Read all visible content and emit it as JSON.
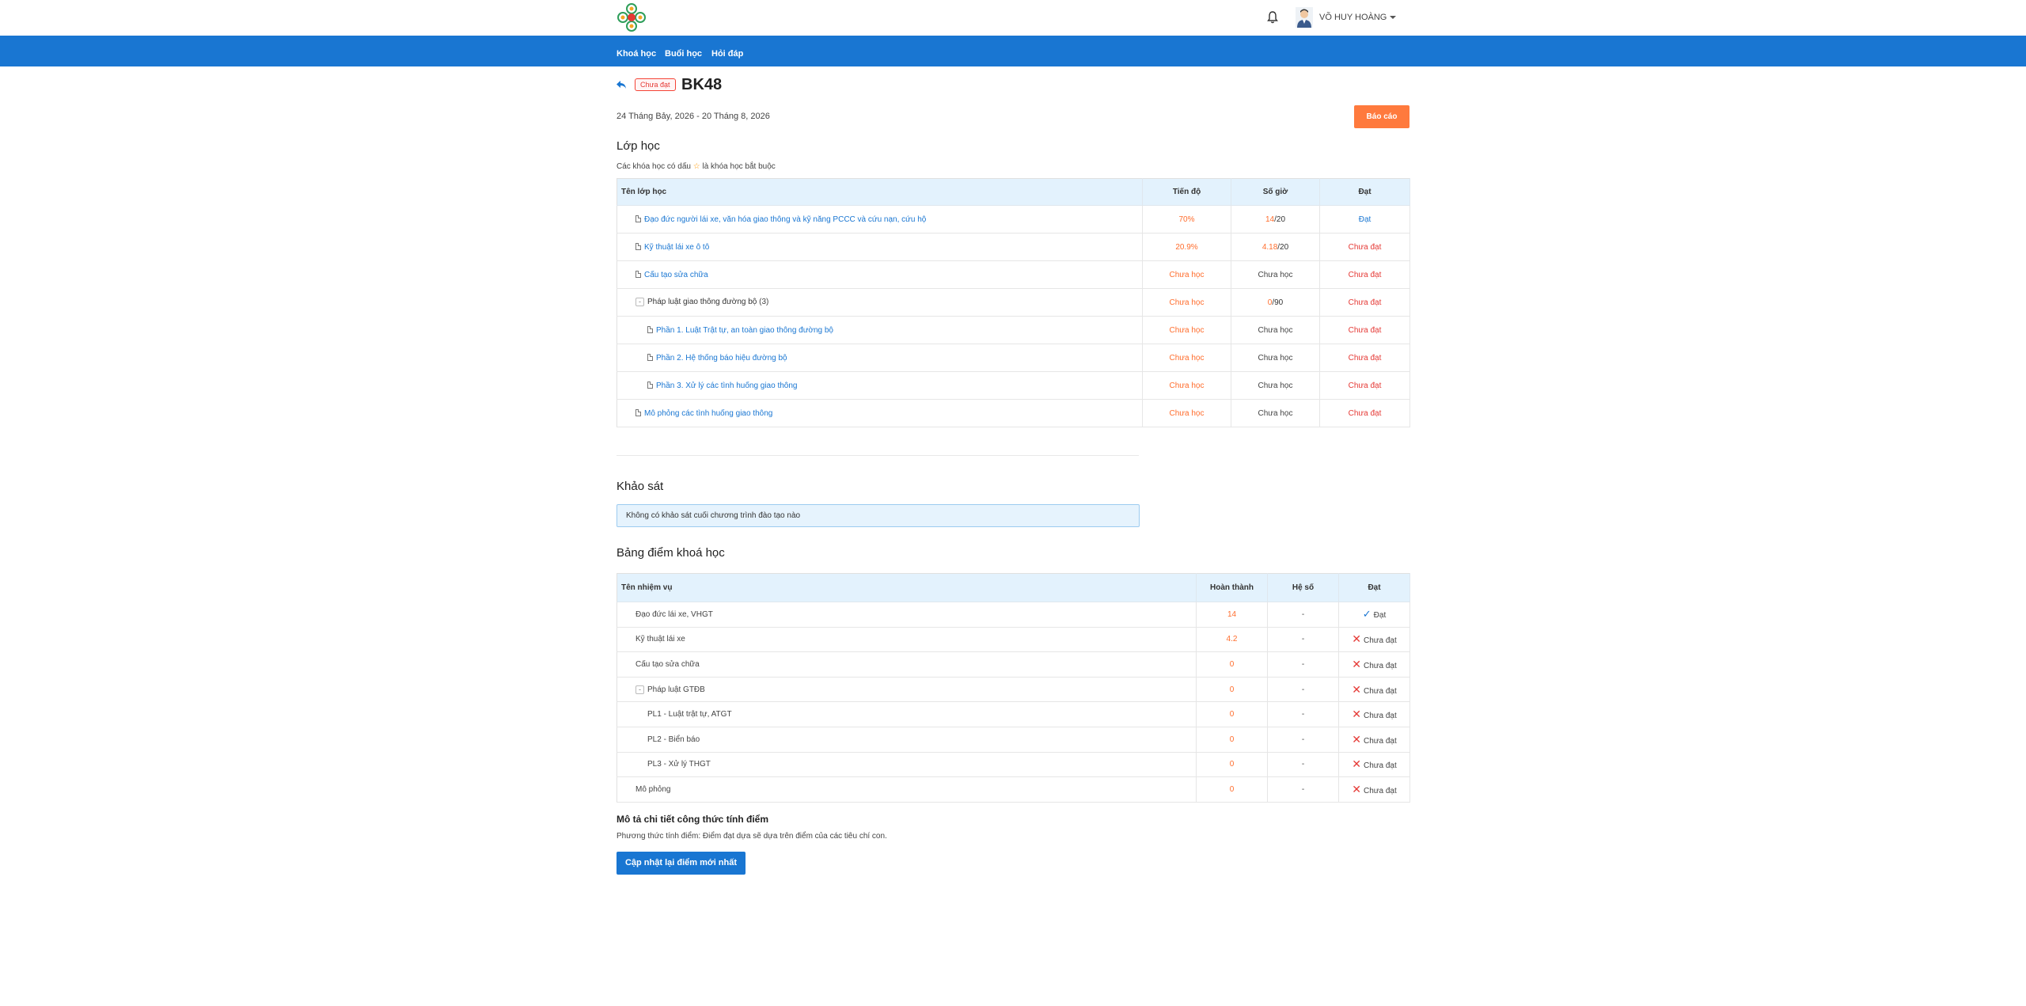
{
  "header": {
    "user_name": "VÕ HUY HOÀNG"
  },
  "nav": {
    "items": [
      {
        "label": "Khoá học"
      },
      {
        "label": "Buổi học"
      },
      {
        "label": "Hỏi đáp"
      }
    ]
  },
  "program": {
    "status": "Chưa đạt",
    "title": "BK48",
    "date_range": "24 Tháng Bảy, 2026 - 20 Tháng 8, 2026",
    "report_label": "Báo cáo"
  },
  "classes": {
    "heading": "Lớp học",
    "note_prefix": "Các khóa học có dấu",
    "note_star": "☆",
    "note_suffix": "là khóa học bắt buộc",
    "columns": {
      "name": "Tên lớp học",
      "progress": "Tiến độ",
      "hours": "Số giờ",
      "result": "Đạt"
    },
    "rows": [
      {
        "name": "Đạo đức người lái xe, văn hóa giao thông và kỹ năng PCCC và cứu nạn, cứu hộ",
        "progress": "70%",
        "hours_done": "14",
        "hours_total": "/20",
        "result": "Đạt"
      },
      {
        "name": "Kỹ thuật lái xe ô tô",
        "progress": "20.9%",
        "hours_done": "4.18",
        "hours_total": "/20",
        "result": "Chưa đạt"
      },
      {
        "name": "Cấu tạo sửa chữa",
        "progress": "Chưa học",
        "hours_text": "Chưa học",
        "result": "Chưa đạt"
      },
      {
        "name": "Pháp luật giao thông đường bộ",
        "count": "(3)",
        "progress": "Chưa học",
        "hours_done": "0",
        "hours_total": "/90",
        "result": "Chưa đạt"
      },
      {
        "name": "Phần 1. Luật Trật tự, an toàn giao thông đường bộ",
        "progress": "Chưa học",
        "hours_text": "Chưa học",
        "result": "Chưa đạt"
      },
      {
        "name": "Phần 2. Hệ thống báo hiệu đường bộ",
        "progress": "Chưa học",
        "hours_text": "Chưa học",
        "result": "Chưa đạt"
      },
      {
        "name": "Phần 3. Xử lý các tình huống giao thông",
        "progress": "Chưa học",
        "hours_text": "Chưa học",
        "result": "Chưa đạt"
      },
      {
        "name": "Mô phỏng các tình huống giao thông",
        "progress": "Chưa học",
        "hours_text": "Chưa học",
        "result": "Chưa đạt"
      }
    ]
  },
  "survey": {
    "heading": "Khảo sát",
    "message": "Không có khảo sát cuối chương trình đào tạo nào"
  },
  "scores": {
    "heading": "Bảng điểm khoá học",
    "columns": {
      "name": "Tên nhiệm vụ",
      "completed": "Hoàn thành",
      "coef": "Hệ số",
      "result": "Đạt"
    },
    "rows": [
      {
        "name": "Đạo đức lái xe, VHGT",
        "completed": "14",
        "coef": "-",
        "result": "Đạt"
      },
      {
        "name": "Kỹ thuật lái xe",
        "completed": "4.2",
        "coef": "-",
        "result": "Chưa đạt"
      },
      {
        "name": "Cấu tạo sửa chữa",
        "completed": "0",
        "coef": "-",
        "result": "Chưa đạt"
      },
      {
        "name": "Pháp luật GTĐB",
        "completed": "0",
        "coef": "-",
        "result": "Chưa đạt"
      },
      {
        "name": "PL1 - Luật trật tự, ATGT",
        "completed": "0",
        "coef": "-",
        "result": "Chưa đạt"
      },
      {
        "name": "PL2 - Biển báo",
        "completed": "0",
        "coef": "-",
        "result": "Chưa đạt"
      },
      {
        "name": "PL3 - Xử lý THGT",
        "completed": "0",
        "coef": "-",
        "result": "Chưa đạt"
      },
      {
        "name": "Mô phỏng",
        "completed": "0",
        "coef": "-",
        "result": "Chưa đạt"
      }
    ]
  },
  "formula": {
    "heading": "Mô tả chi tiết công thức tính điểm",
    "text": "Phương thức tính điểm: Điểm đạt dựa sẽ dựa trên điểm của các tiêu chí con.",
    "update_label": "Cập nhật lại điểm mới nhất"
  },
  "colors": {
    "primary": "#1976d2",
    "accent": "#ff7a3d",
    "danger": "#e53935"
  },
  "icons": [
    "logo-icon",
    "bell-icon",
    "avatar",
    "back-arrow-icon",
    "document-icon",
    "collapse-icon",
    "check-icon",
    "cross-icon"
  ]
}
